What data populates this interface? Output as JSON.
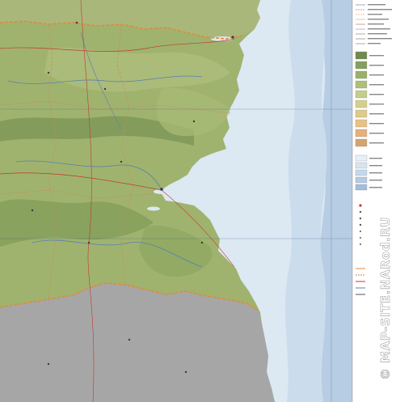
{
  "map": {
    "watermark": "© MAP-SITE.NARod.RU",
    "colors": {
      "sea_shallow": "#dce8f2",
      "sea_mid": "#c6d9ea",
      "sea_deep": "#a9c2dc",
      "lowland": "#9fb36f",
      "upland": "#8aa35e",
      "plateau": "#c9b876",
      "foreign_territory": "#a6a6a6",
      "border": "#e08a3a",
      "river": "#5a7fb0",
      "road": "#c23a2a",
      "legend_bg": "#ffffff"
    },
    "legend": {
      "elevation_swatches": [
        "#6f8a4e",
        "#83a05c",
        "#98b06a",
        "#aebf7a",
        "#c4cd8a",
        "#d6cf8c",
        "#e0c98a",
        "#e8c183",
        "#e6b07a",
        "#d6a36e"
      ],
      "depth_swatches": [
        "#e8f0f7",
        "#d7e5f1",
        "#c5d8eb",
        "#b3cbe3",
        "#a2bedb"
      ]
    }
  }
}
